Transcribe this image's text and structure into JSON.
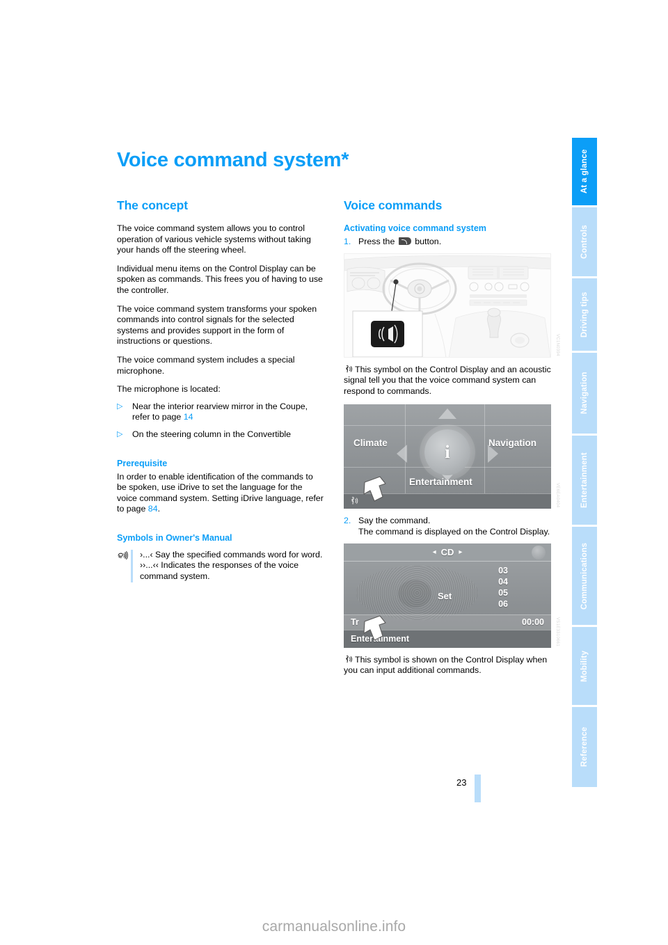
{
  "document": {
    "title": "Voice command system*",
    "page_number": "23",
    "watermark": "carmanualsonline.info"
  },
  "sidebar": {
    "tabs": [
      {
        "label": "At a glance",
        "active": true
      },
      {
        "label": "Controls",
        "active": false
      },
      {
        "label": "Driving tips",
        "active": false
      },
      {
        "label": "Navigation",
        "active": false
      },
      {
        "label": "Entertainment",
        "active": false
      },
      {
        "label": "Communications",
        "active": false
      },
      {
        "label": "Mobility",
        "active": false
      },
      {
        "label": "Reference",
        "active": false
      }
    ]
  },
  "left_column": {
    "concept": {
      "heading": "The concept",
      "paragraphs": [
        "The voice command system allows you to control operation of various vehicle systems without taking your hands off the steering wheel.",
        "Individual menu items on the Control Display can be spoken as commands. This frees you of having to use the controller.",
        "The voice command system transforms your spoken commands into control signals for the selected systems and provides support in the form of instructions or questions.",
        "The voice command system includes a special microphone.",
        "The microphone is located:"
      ],
      "bullets": [
        {
          "text_before": "Near the interior rearview mirror in the Coupe, refer to page ",
          "page_ref": "14",
          "text_after": ""
        },
        {
          "text_before": "On the steering column in the Convertible",
          "page_ref": "",
          "text_after": ""
        }
      ]
    },
    "prerequisite": {
      "heading": "Prerequisite",
      "text_before": "In order to enable identification of the commands to be spoken, use iDrive to set the language for the voice command system. Setting iDrive language, refer to page ",
      "page_ref": "84",
      "text_after": "."
    },
    "symbols": {
      "heading": "Symbols in Owner's Manual",
      "icon": "speech-mouth-icon",
      "line1": "›...‹ Say the specified commands word for word.",
      "line2": "››...‹‹ Indicates the responses of the voice command system."
    }
  },
  "right_column": {
    "heading": "Voice commands",
    "activating": {
      "heading": "Activating voice command system",
      "step1_num": "1.",
      "step1_text_before": "Press the ",
      "step1_text_after": " button.",
      "step1_icon": "voice-button-icon",
      "step2_num": "2.",
      "step2_text": "Say the command.\nThe command is displayed on the Control Display."
    },
    "note1": {
      "icon": "voice-prompt-symbol-icon",
      "text": "This symbol on the Control Display and an acoustic signal tell you that the voice command system can respond to commands."
    },
    "note2": {
      "icon": "voice-prompt-symbol-icon",
      "text": "This symbol is shown on the Control Display when you can input additional commands."
    },
    "figures": {
      "car_interior": {
        "name": "car-interior-illustration",
        "caption_code": "VC1N0394",
        "callout_button": "voice-command-button"
      },
      "idrive_menu": {
        "name": "idrive-main-menu-screenshot",
        "caption_code": "VE6EA0404",
        "items": [
          "Climate",
          "Navigation",
          "Entertainment"
        ],
        "center_icon": "i",
        "status_icon": "voice-prompt-symbol-icon"
      },
      "cd_screen": {
        "name": "cd-playback-screenshot",
        "caption_code": "VS1E3310661",
        "header": "CD",
        "prev_arrow": "◂",
        "next_arrow": "▸",
        "set_label": "Set",
        "tracks": [
          "03",
          "04",
          "05",
          "06"
        ],
        "track_label": "Tr",
        "time": "00:00",
        "footer": "Entertainment"
      }
    }
  },
  "colors": {
    "accent_blue": "#0b9ef7",
    "tab_inactive": "#b9ddfa",
    "screen_gray": "#8e9295"
  }
}
